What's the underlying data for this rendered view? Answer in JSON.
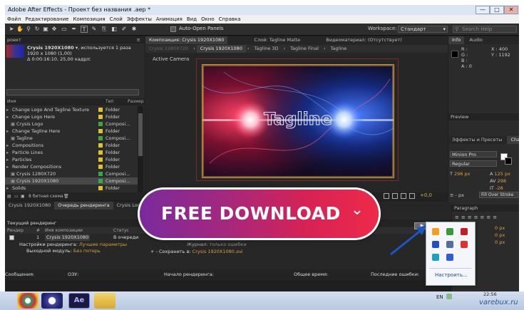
{
  "window": {
    "title": "Adobe After Effects - Проект без названия .aep *",
    "controls": [
      "—",
      "□",
      "✕"
    ]
  },
  "menu": [
    "Файл",
    "Редактирование",
    "Композиция",
    "Слой",
    "Эффекты",
    "Анимация",
    "Вид",
    "Окно",
    "Справка"
  ],
  "toolbar": {
    "auto_open": "Auto-Open Panels",
    "workspace_label": "Workspace:",
    "workspace_value": "Стандарт",
    "search_placeholder": "Search Help"
  },
  "project": {
    "header": "роект",
    "comp_name": "Crysis 1920X1080 ▾",
    "comp_used": ", используется 1 раза",
    "comp_size": "1920 x 1080 (1,00)",
    "comp_dur": "Δ 0:00:16:10, 25,00 кадр/с",
    "col_name": "Имя",
    "col_type": "Тип",
    "col_size": "Размер",
    "bit_depth": "8 битная схема",
    "items": [
      {
        "name": "Change Logo And Tagline Texture",
        "type": "Folder",
        "color": "#e2c12a",
        "indent": 0
      },
      {
        "name": "Change Logo Here",
        "type": "Folder",
        "color": "#e2c12a",
        "indent": 0
      },
      {
        "name": "Crysis Logo",
        "type": "Composi...",
        "color": "#3aa74a",
        "indent": 1
      },
      {
        "name": "Change Tagline Here",
        "type": "Folder",
        "color": "#e2c12a",
        "indent": 0
      },
      {
        "name": "Tagline",
        "type": "Composi...",
        "color": "#3aa74a",
        "indent": 1
      },
      {
        "name": "Compositions",
        "type": "Folder",
        "color": "#e2c12a",
        "indent": 0
      },
      {
        "name": "Particle Lines",
        "type": "Folder",
        "color": "#e2c12a",
        "indent": 0
      },
      {
        "name": "Particles",
        "type": "Folder",
        "color": "#e2c12a",
        "indent": 0
      },
      {
        "name": "Render Compositions",
        "type": "Folder",
        "color": "#e2c12a",
        "indent": 0
      },
      {
        "name": "Crysis 1280X720",
        "type": "Composi...",
        "color": "#3aa74a",
        "indent": 1
      },
      {
        "name": "Crysis 1920X1080",
        "type": "Composi...",
        "color": "#3aa74a",
        "indent": 1
      },
      {
        "name": "Solids",
        "type": "Folder",
        "color": "#e2c12a",
        "indent": 0
      }
    ]
  },
  "composition": {
    "panel_tab": "Композиция: Crysis 1920X1080",
    "tab2": "Слой: Tagline Matte",
    "tab3": "Видеоматериал: (Отсутствует)",
    "breadcrumbs": [
      "Crysis 1280X720",
      "Crysis 1920X1080",
      "Tagline 3D",
      "Tagline Final",
      "Tagline"
    ],
    "view_label": "Active Camera",
    "tagline_text": "Tagline",
    "exposure": "+0,0"
  },
  "info": {
    "tab_info": "Info",
    "tab_audio": "Audio",
    "r": "R :",
    "g": "G :",
    "b": "B :",
    "a": "A : 0",
    "x": "X : 400",
    "y": "Y : 1192"
  },
  "right_panels": {
    "preview": "Preview",
    "effects": "Эффекты и Пресеты",
    "char": "Char",
    "font": "Minion Pro",
    "style": "Regular",
    "size": "296 px",
    "leading": "125 px",
    "tracking": "298",
    "vscale": "-28",
    "px": "px",
    "fill_stroke": "Fill Over Stroke",
    "paragraph": "Paragraph",
    "indent1": "0 px",
    "indent2": "0 px",
    "indent3": "0 px"
  },
  "render": {
    "tabs": [
      "Crysis 1920X1080",
      "Очередь рендеринга",
      "Crysis Logo"
    ],
    "current": "Текущий рендеринг",
    "col_render": "Рендер",
    "col_num": "#",
    "col_comp": "Имя композиции",
    "col_status": "Статус",
    "item_num": "1",
    "item_name": "Crysis 1920X1080",
    "item_status": "В очереди",
    "settings_label": "Настройки рендеринга:",
    "settings_value": "Лучшие параметры",
    "output_label": "Выходной модуль:",
    "output_value": "Без потерь",
    "log_label": "Журнал:",
    "log_value": "только ошибки",
    "save_label": "Сохранить в:",
    "save_value": "Crysis 1920X1080.avi",
    "status_messages": "Сообщения:",
    "status_ram": "ОЗУ:",
    "status_start": "Начало рендеринга:",
    "status_total": "Общее время:",
    "status_errors": "Последние ошибки:"
  },
  "promo": {
    "label": "FREE DOWNLOAD",
    "chevron": "⌄"
  },
  "tray": {
    "customize": "Настроить...",
    "lang": "EN",
    "time": "22:56",
    "watermark": "varebux.ru"
  },
  "taskbar": {
    "ae_label": "Ae"
  }
}
